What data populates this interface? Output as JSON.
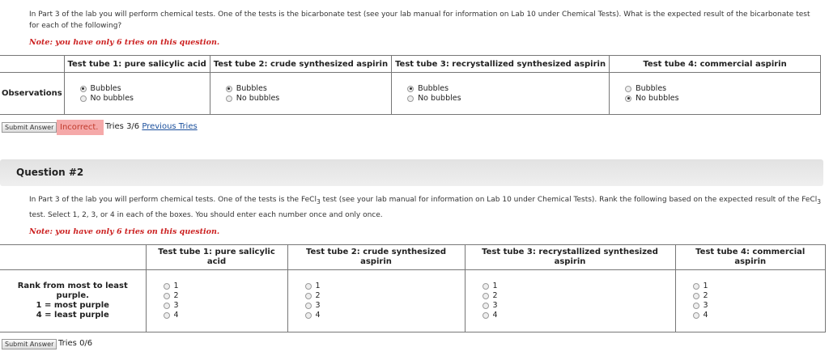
{
  "question1": {
    "intro": "In Part 3 of the lab you will perform chemical tests. One of the tests is the bicarbonate test (see your lab manual for information on Lab 10 under Chemical Tests). What is the expected result of the bicarbonate test for each of the following?",
    "note": "Note: you have only 6 tries on this question.",
    "row_label": "Observations",
    "columns": [
      {
        "header": "Test tube 1: pure salicylic acid",
        "options": [
          "Bubbles",
          "No bubbles"
        ],
        "selected": 0
      },
      {
        "header": "Test tube 2: crude synthesized aspirin",
        "options": [
          "Bubbles",
          "No bubbles"
        ],
        "selected": 0
      },
      {
        "header": "Test tube 3: recrystallized synthesized aspirin",
        "options": [
          "Bubbles",
          "No bubbles"
        ],
        "selected": 0
      },
      {
        "header": "Test tube 4: commercial aspirin",
        "options": [
          "Bubbles",
          "No bubbles"
        ],
        "selected": 1
      }
    ],
    "submit_label": "Submit Answer",
    "status": "Incorrect.",
    "tries": "Tries 3/6",
    "previous_tries": "Previous Tries"
  },
  "question2": {
    "title": "Question #2",
    "intro_a": "In Part 3 of the lab you will perform chemical tests. One of the tests is the FeCl",
    "intro_b": " test (see your lab manual for information on Lab 10 under Chemical Tests). Rank the following based on the expected result of the FeCl",
    "intro_c": " test. Select 1, 2, 3, or 4 in each of the boxes. You should enter each number once and only once.",
    "subscript": "3",
    "note": "Note: you have only 6 tries on this question.",
    "row_label_1": "Rank from most to least purple.",
    "row_label_2": "1 = most purple",
    "row_label_3": "4 = least purple",
    "columns": [
      {
        "header_1": "Test tube 1: pure salicylic",
        "header_2": "acid"
      },
      {
        "header_1": "Test tube 2: crude synthesized",
        "header_2": "aspirin"
      },
      {
        "header_1": "Test tube 3: recrystallized synthesized",
        "header_2": "aspirin"
      },
      {
        "header_1": "Test tube 4: commercial",
        "header_2": "aspirin"
      }
    ],
    "rank_options": [
      "1",
      "2",
      "3",
      "4"
    ],
    "submit_label": "Submit Answer",
    "tries": "Tries 0/6"
  }
}
